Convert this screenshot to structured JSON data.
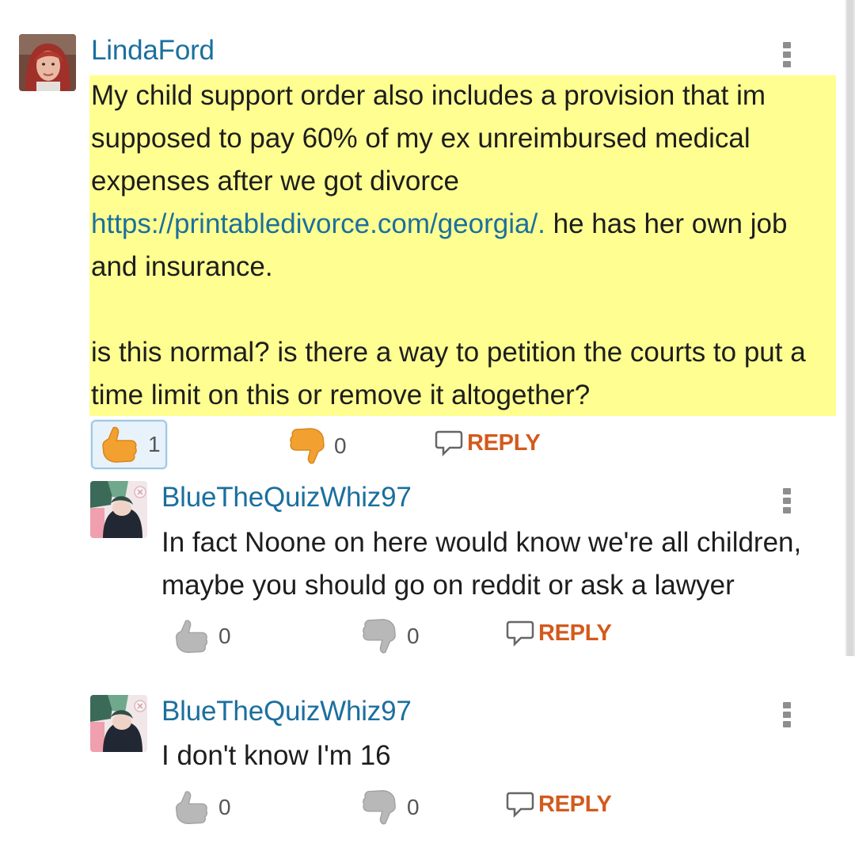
{
  "comments": [
    {
      "username": "LindaFord",
      "body": {
        "line1": "My child support order also includes a provision that im",
        "line2": "supposed to pay 60% of my ex unreimbursed medical",
        "line3": "expenses after we got divorce",
        "link": "https://printabledivorce.com/georgia/.",
        "after_link": " he has her own job",
        "line5": "and insurance.",
        "line6": "is this normal? is there a way to petition the courts to put a",
        "line7": "time limit on this or remove it altogether?"
      },
      "upvotes": "1",
      "downvotes": "0",
      "reply_label": "REPLY",
      "highlighted": true
    },
    {
      "username": "BlueTheQuizWhiz97",
      "body": {
        "line1": "In fact Noone on here would know we're all children,",
        "line2": "maybe you should go on reddit or ask a lawyer"
      },
      "upvotes": "0",
      "downvotes": "0",
      "reply_label": "REPLY"
    },
    {
      "username": "BlueTheQuizWhiz97",
      "body": {
        "line1": "I don't know I'm 16"
      },
      "upvotes": "0",
      "downvotes": "0",
      "reply_label": "REPLY"
    }
  ],
  "icons": {
    "more": "more-vertical-icon",
    "upvote": "thumbs-up-icon",
    "downvote": "thumbs-down-icon",
    "reply": "comment-bubble-icon"
  },
  "colors": {
    "username": "#1b6f9e",
    "link": "#1b6f9e",
    "reply": "#d35a1c",
    "highlight": "#ffff91",
    "active_thumb": "#f2a131",
    "inactive_thumb": "#b8b8b8"
  }
}
